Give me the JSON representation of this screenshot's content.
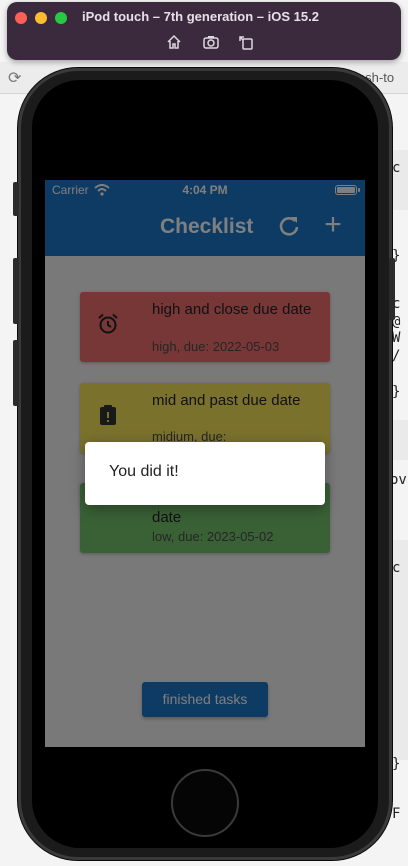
{
  "simulator": {
    "title": "iPod touch – 7th generation – iOS 15.2"
  },
  "background": {
    "url_fragment": "fresh-to",
    "code_snippets": [
      "c",
      "}",
      "c",
      "@",
      "W",
      "/",
      "}",
      "ov",
      "c",
      "}",
      "F"
    ]
  },
  "status_bar": {
    "carrier": "Carrier",
    "time": "4:04 PM"
  },
  "app_bar": {
    "title": "Checklist",
    "refresh_icon": "refresh-icon",
    "add_icon": "add-icon",
    "add_glyph": "+"
  },
  "tasks": [
    {
      "title": "high and close due date",
      "subtitle": "high, due: 2022-05-03",
      "icon": "alarm-icon",
      "color": "#f16f6f"
    },
    {
      "title": "mid and past due date",
      "subtitle": "midium, due:",
      "icon": "pending-actions-icon",
      "color": "#f5e25a"
    },
    {
      "title": "date",
      "subtitle": "low, due: 2023-05-02",
      "icon": "none",
      "color": "#74c26c"
    }
  ],
  "finished_button": {
    "label": "finished tasks"
  },
  "dialog": {
    "message": "You did it!"
  },
  "colors": {
    "primary": "#1a76c6",
    "scrim": "rgba(0,0,0,0.5)"
  }
}
